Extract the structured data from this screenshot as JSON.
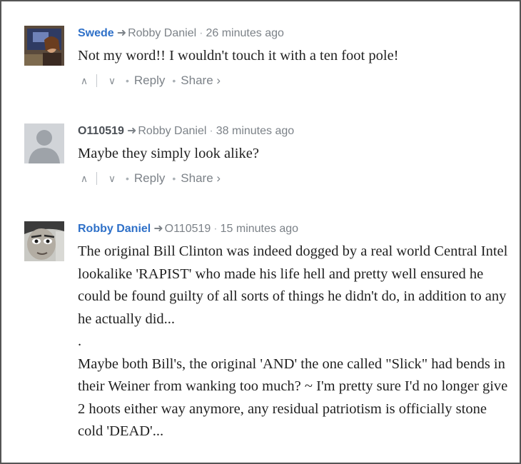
{
  "comments": [
    {
      "author": "Swede",
      "reply_to": "Robby Daniel",
      "time": "26 minutes ago",
      "text": [
        "Not my word!! I wouldn't touch it with a ten foot pole!"
      ],
      "actions": {
        "reply": "Reply",
        "share": "Share ›"
      }
    },
    {
      "author": "O110519",
      "reply_to": "Robby Daniel",
      "time": "38 minutes ago",
      "text": [
        "Maybe they simply look alike?"
      ],
      "actions": {
        "reply": "Reply",
        "share": "Share ›"
      }
    },
    {
      "author": "Robby Daniel",
      "reply_to": "O110519",
      "time": "15 minutes ago",
      "text": [
        "The original Bill Clinton was indeed dogged by a real world Central Intel lookalike 'RAPIST' who made his life hell and pretty well ensured he could be found guilty of all sorts of things he didn't do, in addition to any he actually did...",
        ".",
        "Maybe both Bill's, the original 'AND' the one called \"Slick\" had bends in their Weiner from wanking too much? ~ I'm pretty sure I'd no longer give 2 hoots either way anymore, any residual patriotism is officially stone cold 'DEAD'..."
      ]
    }
  ],
  "icons": {
    "reply_arrow": "arrow-right-icon",
    "upvote": "chevron-up-icon",
    "downvote": "chevron-down-icon"
  },
  "colors": {
    "author_link": "#2e70c8",
    "meta_text": "#7c8288",
    "comment_text": "#222222",
    "frame_border": "#555555"
  }
}
